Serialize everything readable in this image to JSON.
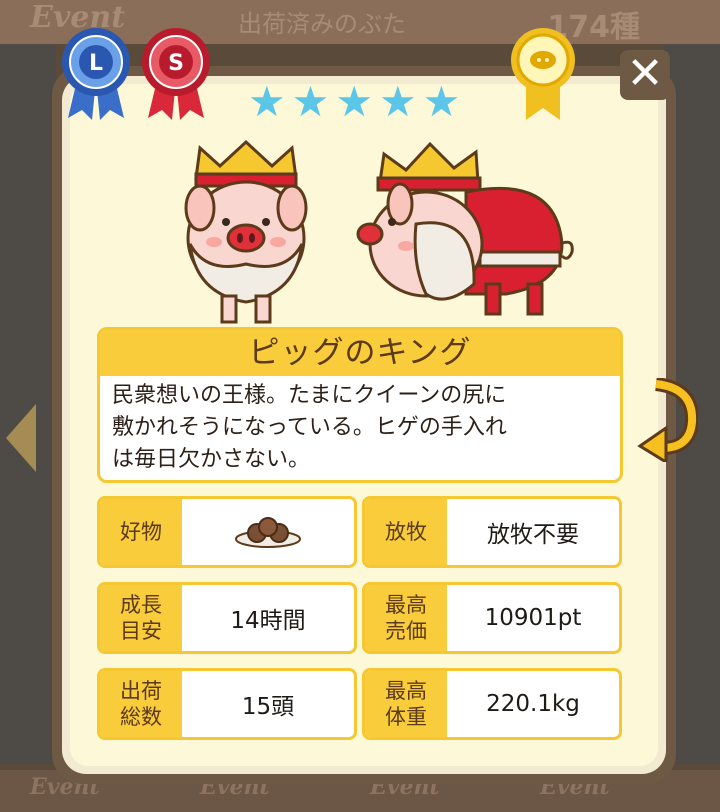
{
  "header": {
    "event_label": "Event",
    "title": "出荷済みのぶた",
    "count": "174種"
  },
  "footer": {
    "tabs": [
      "Event",
      "Event",
      "Event",
      "Event"
    ]
  },
  "badges": {
    "left_ribbon_letter": "L",
    "right_ribbon_letter": "S"
  },
  "rating": {
    "stars": 5,
    "stars_text": "★★★★★"
  },
  "close_label": "✕",
  "pig": {
    "name": "ピッグのキング",
    "description_lines": [
      "民衆想いの王様。たまにクイーンの尻に",
      "敷かれそうになっている。ヒゲの手入れ",
      "は毎日欠かさない。"
    ]
  },
  "stats": {
    "favorite": {
      "label": "好物",
      "icon": "food-plate-icon"
    },
    "grazing": {
      "label": "放牧",
      "value": "放牧不要"
    },
    "growth": {
      "label_l1": "成長",
      "label_l2": "目安",
      "value": "14時間"
    },
    "max_price": {
      "label_l1": "最高",
      "label_l2": "売価",
      "value": "10901pt"
    },
    "shipped": {
      "label_l1": "出荷",
      "label_l2": "総数",
      "value": "15頭"
    },
    "max_weight": {
      "label_l1": "最高",
      "label_l2": "体重",
      "value": "220.1kg"
    }
  },
  "colors": {
    "accent_yellow": "#f8cc3a",
    "star_blue": "#5cc6e8",
    "panel_brown": "#6e5a44",
    "cream": "#fdf8d8"
  }
}
